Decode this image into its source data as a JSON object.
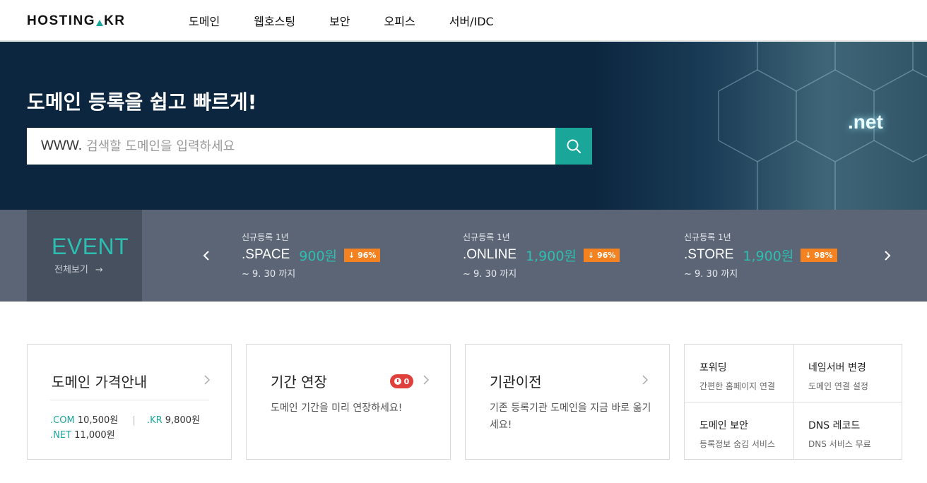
{
  "header": {
    "logo": {
      "left": "HOSTING",
      "right": "KR"
    },
    "nav": [
      "도메인",
      "웹호스팅",
      "보안",
      "오피스",
      "서버/IDC"
    ]
  },
  "hero": {
    "title": "도메인 등록을 쉽고 빠르게!",
    "search_prefix": "WWW.",
    "search_placeholder": "검색할 도메인을 입력하세요",
    "image_text": ".net",
    "search_icon": "search-icon"
  },
  "event": {
    "title": "EVENT",
    "view_all": "전체보기",
    "promos": [
      {
        "label": "신규등록 1년",
        "tld": ".SPACE",
        "price": "900원",
        "discount": "↓ 96%",
        "period": "~ 9. 30 까지"
      },
      {
        "label": "신규등록 1년",
        "tld": ".ONLINE",
        "price": "1,900원",
        "discount": "↓ 96%",
        "period": "~ 9. 30 까지"
      },
      {
        "label": "신규등록 1년",
        "tld": ".STORE",
        "price": "1,900원",
        "discount": "↓ 98%",
        "period": "~ 9. 30 까지"
      }
    ]
  },
  "cards": {
    "price": {
      "title": "도메인 가격안내",
      "com_tld": ".COM",
      "com_price": "10,500원",
      "kr_tld": ".KR",
      "kr_price": "9,800원",
      "net_tld": ".NET",
      "net_price": "11,000원"
    },
    "renew": {
      "title": "기간 연장",
      "badge": "0",
      "desc": "도메인 기간을 미리 연장하세요!"
    },
    "transfer": {
      "title": "기관이전",
      "desc": "기존 등록기관 도메인을 지금 바로 옮기세요!"
    },
    "grid": [
      {
        "title": "포워딩",
        "sub": "간편한 홈페이지 연결"
      },
      {
        "title": "네임서버 변경",
        "sub": "도메인 연결 설정"
      },
      {
        "title": "도메인 보안",
        "sub": "등록정보 숨김 서비스"
      },
      {
        "title": "DNS 레코드",
        "sub": "DNS 서비스 무료"
      }
    ]
  },
  "colors": {
    "accent": "#1aa79a",
    "hero_bg": "#0c2640",
    "event_bg": "#5b6575",
    "badge_orange": "#f58220",
    "badge_red": "#e0403b"
  }
}
